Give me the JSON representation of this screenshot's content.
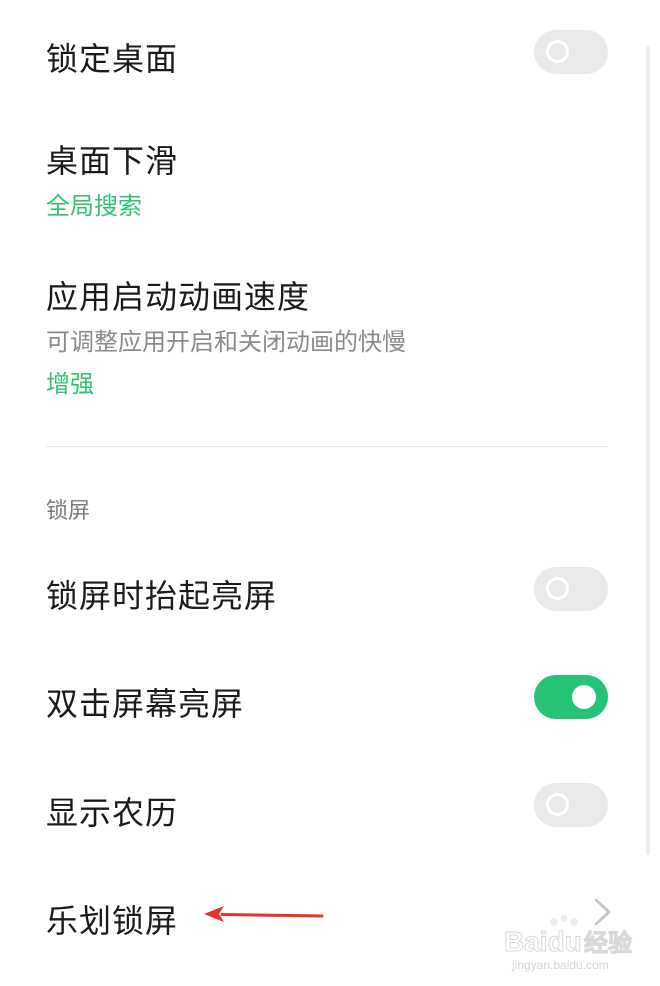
{
  "settings": {
    "lock_desktop": {
      "label": "锁定桌面",
      "toggle_on": false
    },
    "swipe_down": {
      "label": "桌面下滑",
      "value": "全局搜索"
    },
    "anim_speed": {
      "label": "应用启动动画速度",
      "description": "可调整应用开启和关闭动画的快慢",
      "value": "增强"
    }
  },
  "lock_screen_section": {
    "header": "锁屏",
    "items": [
      {
        "label": "锁屏时抬起亮屏",
        "toggle_on": false
      },
      {
        "label": "双击屏幕亮屏",
        "toggle_on": true
      },
      {
        "label": "显示农历",
        "toggle_on": false
      },
      {
        "label": "乐划锁屏",
        "chevron": "chevron-right-icon"
      }
    ]
  },
  "watermark": {
    "brand": "Baidu",
    "brand_cn": "经验",
    "url": "jingyan.baidu.com"
  },
  "colors": {
    "accent_green": "#2fc36f",
    "toggle_on": "#25c375",
    "toggle_off": "#e9e9e9",
    "annotation_red": "#e8312b"
  }
}
